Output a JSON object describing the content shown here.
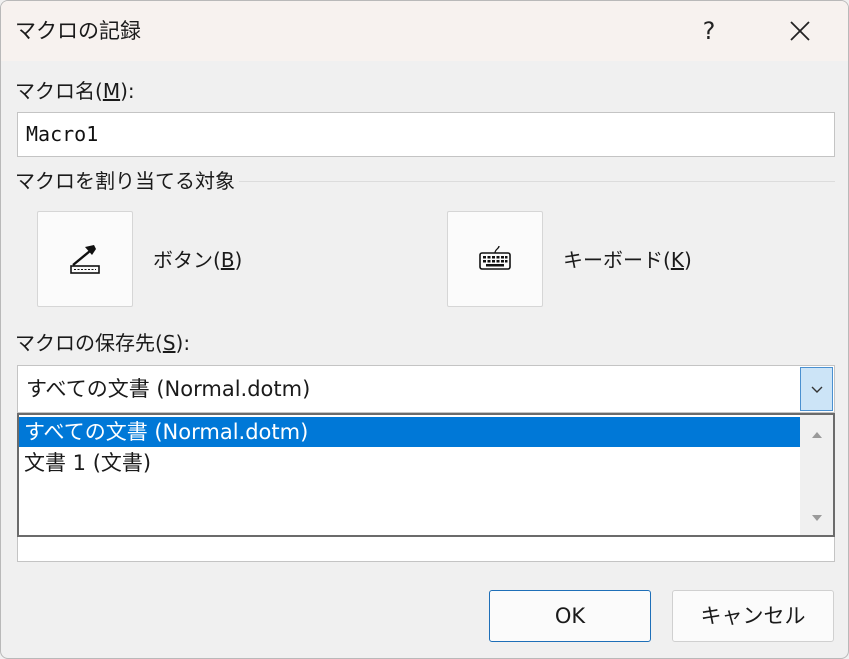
{
  "window": {
    "title": "マクロの記録",
    "help_label": "?"
  },
  "macro_name": {
    "label_text": "マクロ名(",
    "label_key": "M",
    "label_end": "):",
    "value": "Macro1"
  },
  "assign": {
    "group_label": "マクロを割り当てる対象",
    "button": {
      "label_text": "ボタン(",
      "label_key": "B",
      "label_end": ")",
      "icon": "toolbar-button-icon"
    },
    "keyboard": {
      "label_text": "キーボード(",
      "label_key": "K",
      "label_end": ")",
      "icon": "keyboard-icon"
    }
  },
  "store": {
    "label_text": "マクロの保存先(",
    "label_key": "S",
    "label_end": "):",
    "selected": "すべての文書 (Normal.dotm)",
    "options": [
      "すべての文書 (Normal.dotm)",
      "文書 1 (文書)"
    ],
    "selected_index": 0
  },
  "buttons": {
    "ok": "OK",
    "cancel": "キャンセル"
  },
  "colors": {
    "selection": "#0078d7",
    "accent_border": "#1e6fb8",
    "combo_arrow_bg": "#cce4f7"
  }
}
